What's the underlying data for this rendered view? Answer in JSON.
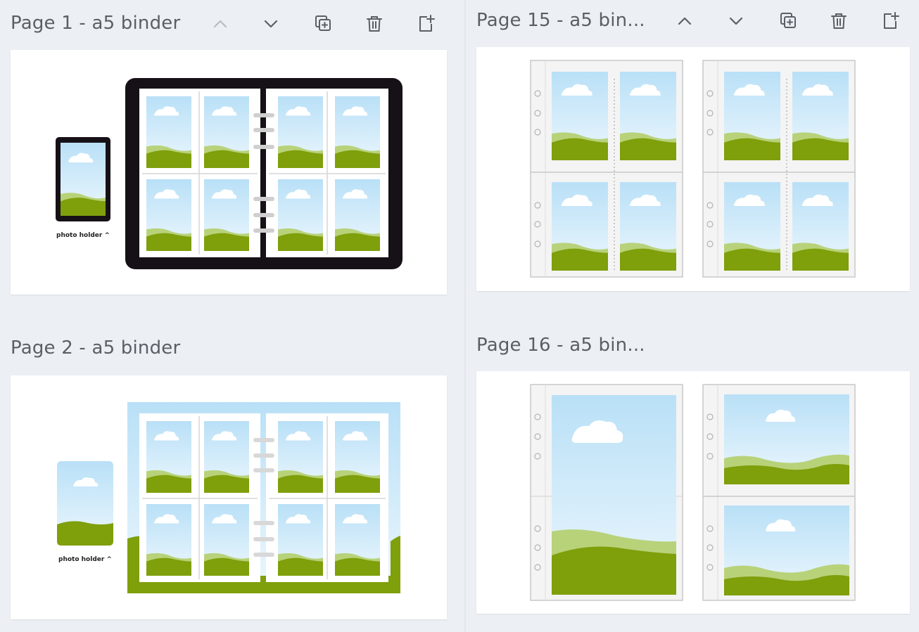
{
  "pages": [
    {
      "title": "Page 1 - a5 binder",
      "has_toolbar": true,
      "move_up_disabled": true,
      "thumbnail_caption": "photo holder ^"
    },
    {
      "title": "Page 2 - a5 binder",
      "has_toolbar": false,
      "thumbnail_caption": "photo holder ^"
    },
    {
      "title": "Page 15 - a5 bin...",
      "has_toolbar": true,
      "move_up_disabled": false
    },
    {
      "title": "Page 16 - a5 bin...",
      "has_toolbar": false
    }
  ],
  "toolbar": {
    "icons": [
      "chevron-up-icon",
      "chevron-down-icon",
      "duplicate-icon",
      "trash-icon",
      "add-page-icon"
    ]
  },
  "colors": {
    "background": "#eceff3",
    "canvas": "#ffffff",
    "sky_top": "#b9e0f7",
    "grass": "#7f9f0b",
    "grass_light": "#b8d27a",
    "binder": "#161116"
  }
}
